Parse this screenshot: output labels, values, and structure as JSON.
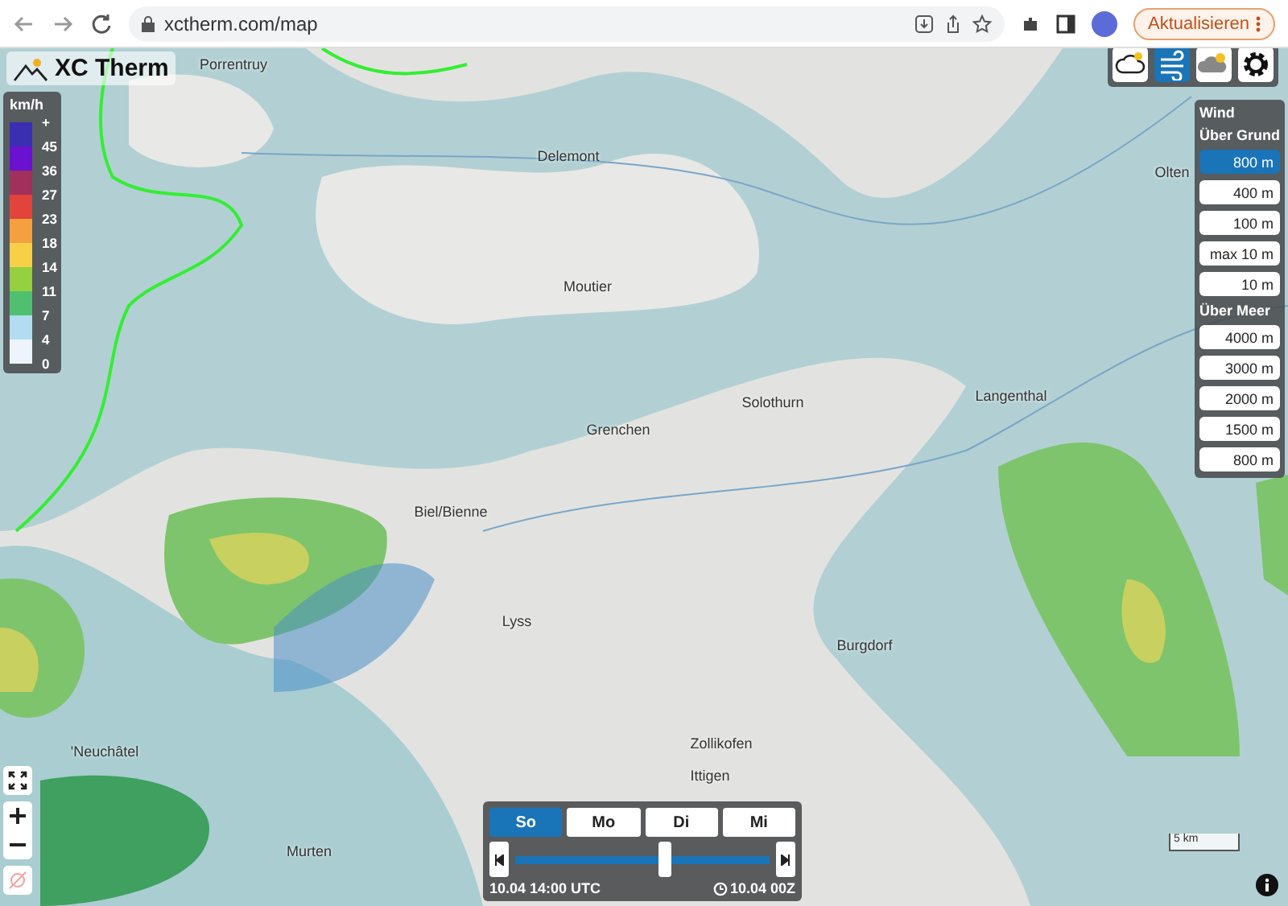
{
  "browser": {
    "url": "xctherm.com/map",
    "update_button": "Aktualisieren"
  },
  "logo": "XC Therm",
  "layer_buttons": [
    {
      "selected": false
    },
    {
      "selected": true
    },
    {
      "selected": false
    }
  ],
  "legend": {
    "unit": "km/h",
    "items": [
      {
        "label": "+",
        "color": "#3a2fb0"
      },
      {
        "label": "45",
        "color": "#6a12d0"
      },
      {
        "label": "36",
        "color": "#a0305c"
      },
      {
        "label": "27",
        "color": "#e0443a"
      },
      {
        "label": "23",
        "color": "#f4a040"
      },
      {
        "label": "18",
        "color": "#f8d048"
      },
      {
        "label": "14",
        "color": "#94d040"
      },
      {
        "label": "11",
        "color": "#50c070"
      },
      {
        "label": "7",
        "color": "#b4dcf0"
      },
      {
        "label": "4",
        "color": "#eef4fb"
      }
    ],
    "bottom_label": "0"
  },
  "wind_panel": {
    "title": "Wind",
    "sections": [
      {
        "heading": "Über Grund",
        "options": [
          {
            "label": "800 m",
            "selected": true
          },
          {
            "label": "400 m",
            "selected": false
          },
          {
            "label": "100 m",
            "selected": false
          },
          {
            "label": "max 10 m",
            "selected": false
          },
          {
            "label": "10 m",
            "selected": false
          }
        ]
      },
      {
        "heading": "Über Meer",
        "options": [
          {
            "label": "4000 m",
            "selected": false
          },
          {
            "label": "3000 m",
            "selected": false
          },
          {
            "label": "2000 m",
            "selected": false
          },
          {
            "label": "1500 m",
            "selected": false
          },
          {
            "label": "800 m",
            "selected": false
          }
        ]
      }
    ]
  },
  "places": [
    {
      "name": "Porrentruy"
    },
    {
      "name": "Delemont"
    },
    {
      "name": "Moutier"
    },
    {
      "name": "Grenchen"
    },
    {
      "name": "Solothurn"
    },
    {
      "name": "Langenthal"
    },
    {
      "name": "Olten"
    },
    {
      "name": "Biel/Bienne"
    },
    {
      "name": "Lyss"
    },
    {
      "name": "Burgdorf"
    },
    {
      "name": "Zollikofen"
    },
    {
      "name": "Ittigen"
    },
    {
      "name": "'Neuchâtel"
    },
    {
      "name": "Murten"
    }
  ],
  "time_panel": {
    "days": [
      {
        "label": "So",
        "selected": true
      },
      {
        "label": "Mo",
        "selected": false
      },
      {
        "label": "Di",
        "selected": false
      },
      {
        "label": "Mi",
        "selected": false
      }
    ],
    "level": 0.59,
    "time": "10.04 14:00 UTC",
    "run": "10.04 00Z"
  },
  "scale": "5 km"
}
